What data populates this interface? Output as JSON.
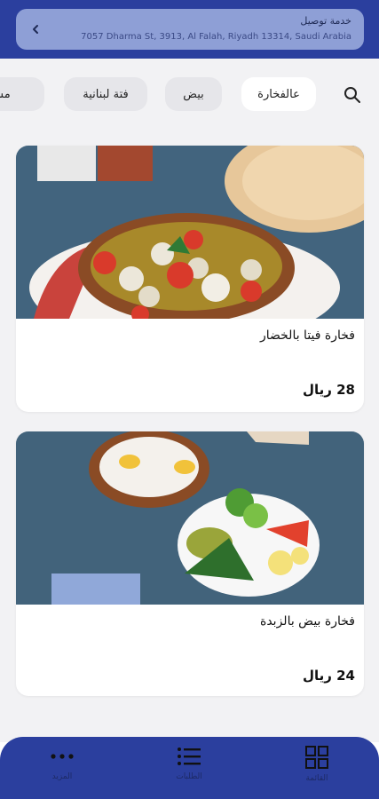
{
  "header": {
    "title": "خدمة توصيل",
    "address": "7057 Dharma St, 3913, Al Falah, Riyadh 13314, Saudi Arabia"
  },
  "categories": [
    {
      "label": "عالفخارة",
      "active": true
    },
    {
      "label": "بيض",
      "active": false
    },
    {
      "label": "فتة لبنانية",
      "active": false
    },
    {
      "label": "مشر",
      "active": false
    }
  ],
  "products": [
    {
      "name": "فخارة فيتا بالخضار",
      "price": "28 ريال"
    },
    {
      "name": "فخارة بيض بالزبدة",
      "price": "24 ريال"
    }
  ],
  "bottom_nav": [
    {
      "label": "القائمة",
      "icon": "grid-icon"
    },
    {
      "label": "الطلبات",
      "icon": "list-icon"
    },
    {
      "label": "المزيد",
      "icon": "more-icon"
    }
  ],
  "colors": {
    "brand": "#2b3f9e",
    "address_card": "#8e9fd6",
    "background": "#f2f2f4"
  }
}
